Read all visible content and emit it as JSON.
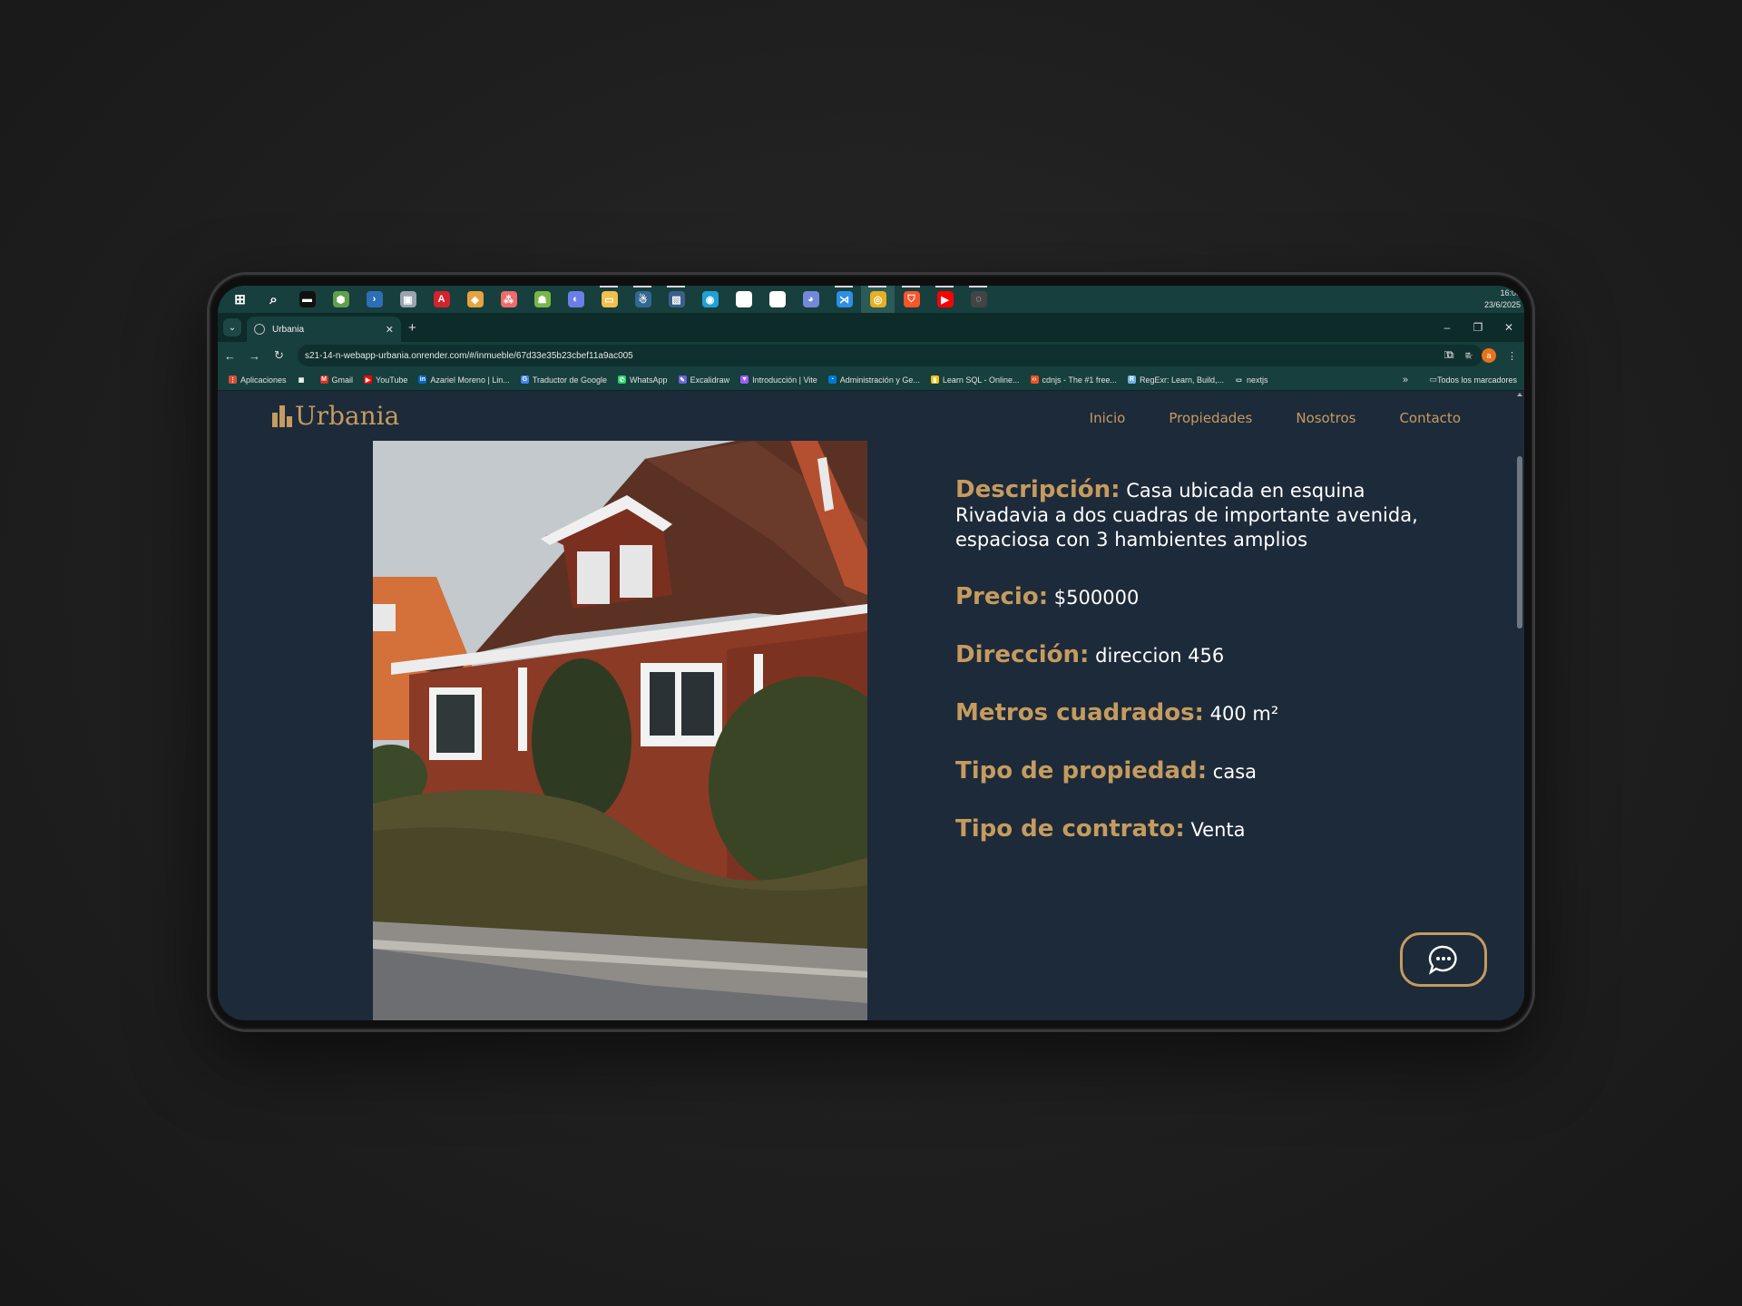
{
  "taskbar": {
    "icons": [
      {
        "name": "windows-start-icon",
        "color": "#ffffff",
        "glyph": "⊞"
      },
      {
        "name": "search-icon",
        "color": "#ffffff",
        "glyph": "⌕"
      },
      {
        "name": "terminal-icon",
        "color": "#111111",
        "glyph": "▬"
      },
      {
        "name": "nodejs-icon",
        "color": "#5fa04e",
        "glyph": "⬢"
      },
      {
        "name": "powershell-icon",
        "color": "#2d6fb7",
        "glyph": "›"
      },
      {
        "name": "image-viewer-icon",
        "color": "#9aa3ad",
        "glyph": "▣"
      },
      {
        "name": "acrobat-icon",
        "color": "#d4232b",
        "glyph": "A"
      },
      {
        "name": "git-icon",
        "color": "#e7a33e",
        "glyph": "◆"
      },
      {
        "name": "asana-icon",
        "color": "#f06a6a",
        "glyph": "⁂"
      },
      {
        "name": "android-icon",
        "color": "#7ab648",
        "glyph": "☗"
      },
      {
        "name": "copilot-icon",
        "color": "#6b7ee8",
        "glyph": "◐"
      },
      {
        "name": "file-explorer-icon",
        "color": "#f3c04b",
        "glyph": "▭"
      },
      {
        "name": "postgresql-icon",
        "color": "#336791",
        "glyph": "☃"
      },
      {
        "name": "dbeaver-icon",
        "color": "#3b5f8a",
        "glyph": "▧"
      },
      {
        "name": "edge-icon",
        "color": "#1fa1d6",
        "glyph": "◉"
      },
      {
        "name": "mongodb-compass-icon",
        "color": "#ffffff",
        "glyph": "●"
      },
      {
        "name": "github-icon",
        "color": "#ffffff",
        "glyph": "◍"
      },
      {
        "name": "discord-icon",
        "color": "#7289da",
        "glyph": "◕"
      },
      {
        "name": "vscode-icon",
        "color": "#2f8ee6",
        "glyph": "⋊"
      },
      {
        "name": "chrome-icon",
        "color": "#e6b020",
        "glyph": "◎"
      },
      {
        "name": "brave-icon",
        "color": "#fb542b",
        "glyph": "⛉"
      },
      {
        "name": "youtube-music-icon",
        "color": "#ff0000",
        "glyph": "▶"
      },
      {
        "name": "obs-icon",
        "color": "#444444",
        "glyph": "◌"
      }
    ],
    "clock_time": "16:06",
    "clock_date": "23/6/2025"
  },
  "browser": {
    "tab_title": "Urbania",
    "url": "s21-14-n-webapp-urbania.onrender.com/#/inmueble/67d33e35b23cbef11a9ac005",
    "profile_initial": "a",
    "bookmarks": [
      {
        "label": "Aplicaciones",
        "color": "#e04b3a",
        "glyph": "⋮"
      },
      {
        "label": "",
        "color": "#173f3d",
        "glyph": "▦"
      },
      {
        "label": "Gmail",
        "color": "#d93025",
        "glyph": "M"
      },
      {
        "label": "YouTube",
        "color": "#ff0000",
        "glyph": "▶"
      },
      {
        "label": "Azariel Moreno | Lin...",
        "color": "#0a66c2",
        "glyph": "in"
      },
      {
        "label": "Traductor de Google",
        "color": "#4285f4",
        "glyph": "G"
      },
      {
        "label": "WhatsApp",
        "color": "#25d366",
        "glyph": "✆"
      },
      {
        "label": "Excalidraw",
        "color": "#6965db",
        "glyph": "✎"
      },
      {
        "label": "Introducción | Vite",
        "color": "#a259ff",
        "glyph": "▼"
      },
      {
        "label": "Administración y Ge...",
        "color": "#0078d4",
        "glyph": "◔"
      },
      {
        "label": "Learn SQL - Online...",
        "color": "#f0c419",
        "glyph": "▮"
      },
      {
        "label": "cdnjs - The #1 free...",
        "color": "#e95420",
        "glyph": "‹›"
      },
      {
        "label": "RegExr: Learn, Build,...",
        "color": "#70b0e0",
        "glyph": "R"
      },
      {
        "label": "nextjs",
        "color": "#173f3d",
        "glyph": "▭"
      }
    ],
    "all_bookmarks": "Todos los marcadores"
  },
  "site": {
    "brand": "Urbania",
    "nav": [
      "Inicio",
      "Propiedades",
      "Nosotros",
      "Contacto"
    ],
    "details": [
      {
        "label": "Descripción:",
        "value": "Casa ubicada en esquina Rivadavia a dos cuadras de importante avenida, espaciosa con 3 hambientes amplios"
      },
      {
        "label": "Precio:",
        "value": "$500000"
      },
      {
        "label": "Dirección:",
        "value": "direccion 456"
      },
      {
        "label": "Metros cuadrados:",
        "value": "400 m²"
      },
      {
        "label": "Tipo de propiedad:",
        "value": "casa"
      },
      {
        "label": "Tipo de contrato:",
        "value": "Venta"
      }
    ],
    "accent_color": "#c59b5e",
    "background_color": "#1d2a3a"
  }
}
